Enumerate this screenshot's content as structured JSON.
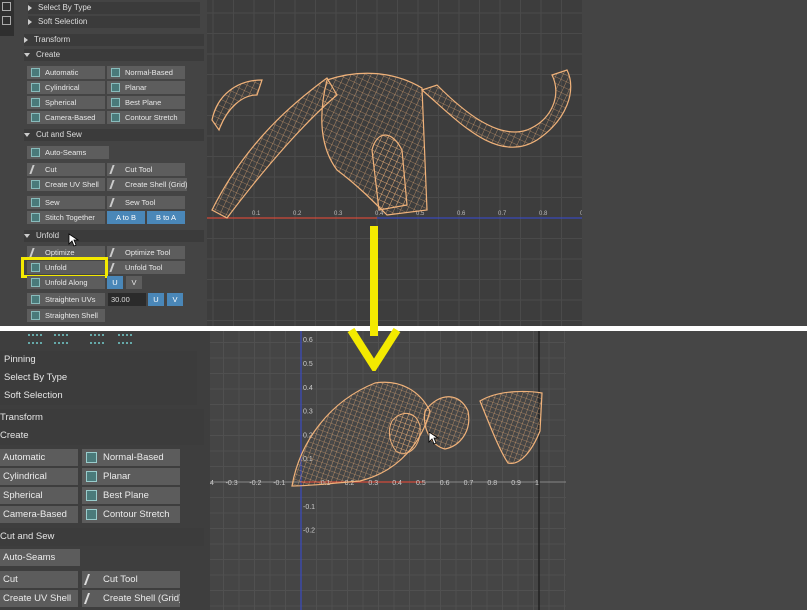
{
  "top_panel": {
    "sections": {
      "select_by_type": "Select By Type",
      "soft_selection": "Soft Selection",
      "transform": "Transform",
      "create": "Create",
      "cut_and_sew": "Cut and Sew",
      "unfold": "Unfold"
    },
    "create_buttons": [
      "Automatic",
      "Normal-Based",
      "Cylindrical",
      "Planar",
      "Spherical",
      "Best Plane",
      "Camera-Based",
      "Contour Stretch"
    ],
    "auto_seams": "Auto-Seams",
    "cut": "Cut",
    "cut_tool": "Cut Tool",
    "create_uv_shell": "Create UV Shell",
    "create_shell_grid": "Create Shell (Grid)",
    "sew": "Sew",
    "sew_tool": "Sew Tool",
    "stitch_together": "Stitch Together",
    "a_to_b": "A to B",
    "b_to_a": "B to A",
    "optimize": "Optimize",
    "optimize_tool": "Optimize Tool",
    "unfold": "Unfold",
    "unfold_tool": "Unfold Tool",
    "unfold_along": "Unfold Along",
    "u": "U",
    "v": "V",
    "straighten_uvs": "Straighten UVs",
    "straighten_value": "30.00",
    "straighten_shell": "Straighten Shell",
    "axis_ticks": [
      "0.1",
      "0.2",
      "0.3",
      "0.4",
      "0.5",
      "0.6",
      "0.7",
      "0.8",
      "0.9"
    ]
  },
  "bottom_panel": {
    "sections": {
      "pinning": "Pinning",
      "select_by_type": "Select By Type",
      "soft_selection": "Soft Selection",
      "transform": "Transform",
      "create": "Create",
      "cut_and_sew": "Cut and Sew"
    },
    "create_buttons": [
      "Automatic",
      "Normal-Based",
      "Cylindrical",
      "Planar",
      "Spherical",
      "Best Plane",
      "Camera-Based",
      "Contour Stretch"
    ],
    "auto_seams": "Auto-Seams",
    "cut": "Cut",
    "cut_tool": "Cut Tool",
    "create_uv_shell": "Create UV Shell",
    "create_shell_grid": "Create Shell (Grid)",
    "x_ticks": [
      "-0.4",
      "-0.3",
      "-0.2",
      "-0.1",
      "0.1",
      "0.2",
      "0.3",
      "0.4",
      "0.5",
      "0.6",
      "0.7",
      "0.8",
      "0.9",
      "1"
    ],
    "y_ticks": [
      "0.6",
      "0.5",
      "0.4",
      "0.3",
      "0.2",
      "0.1",
      "-0.1",
      "-0.2"
    ]
  },
  "colors": {
    "highlight": "#f4ea00",
    "arrow": "#f4ea00",
    "wireframe": "#f0b27a",
    "u_axis": "#d04a3a",
    "v_axis": "#3a4ab8"
  }
}
